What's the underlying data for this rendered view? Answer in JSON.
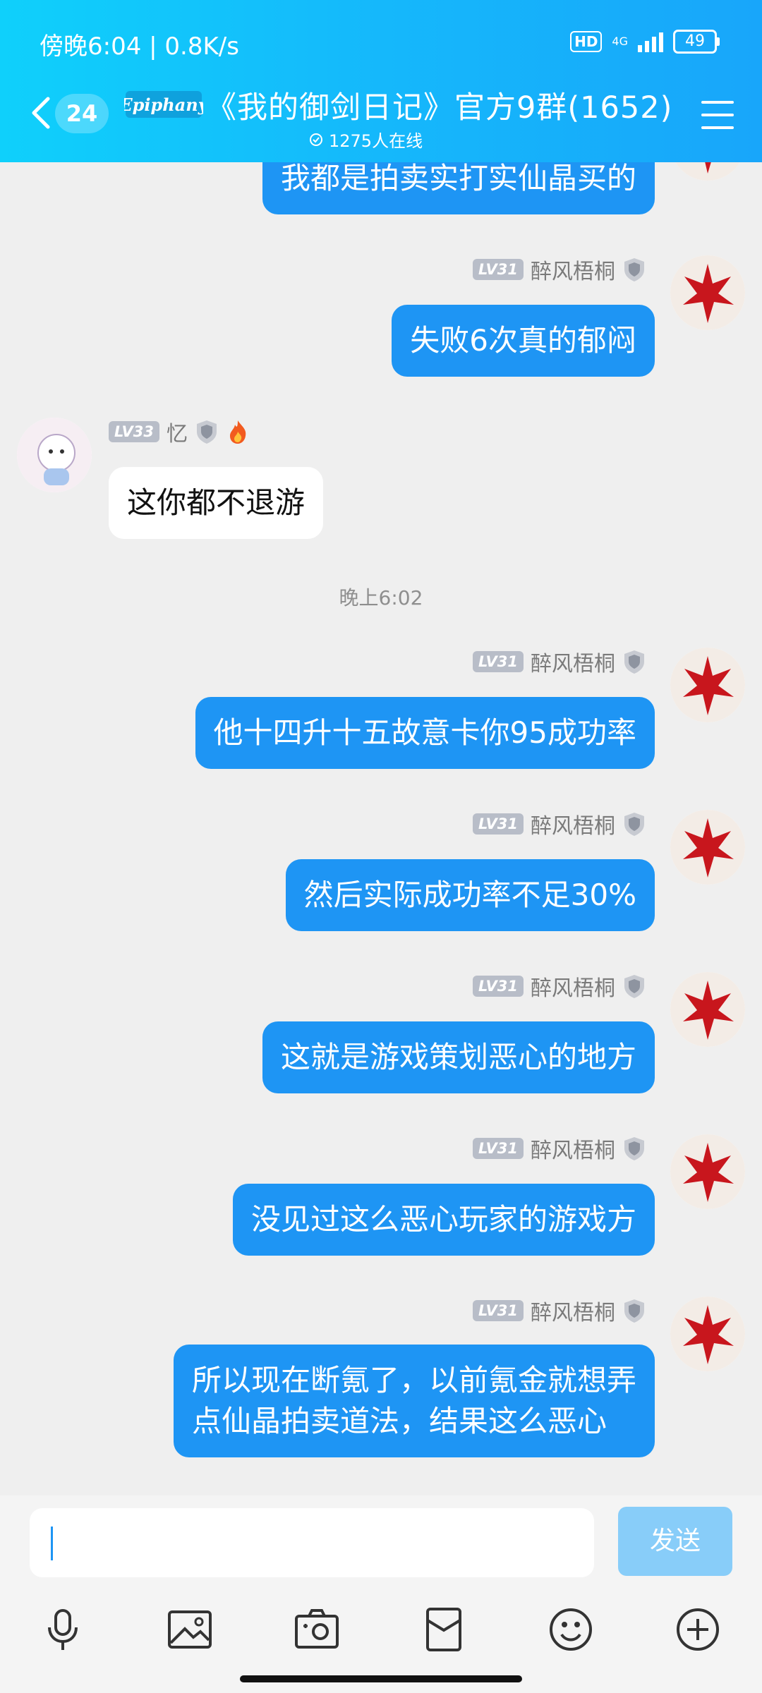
{
  "status_bar": {
    "time_speed": "傍晚6:04 | 0.8K/s",
    "hd": "HD",
    "network": "4G",
    "battery": "49"
  },
  "header": {
    "unread_count": "24",
    "logo_text": "Epiphany",
    "title": "《我的御剑日记》官方9群(1652)",
    "online_count": "1275人在线"
  },
  "messages": [
    {
      "side": "right",
      "text": "我都是拍卖实打实仙晶买的"
    },
    {
      "side": "right",
      "level": "LV31",
      "nick": "醉风梧桐",
      "text": "失败6次真的郁闷"
    },
    {
      "side": "left",
      "level": "LV33",
      "nick": "忆",
      "text": "这你都不退游"
    },
    {
      "type": "time",
      "text": "晚上6:02"
    },
    {
      "side": "right",
      "level": "LV31",
      "nick": "醉风梧桐",
      "text": "他十四升十五故意卡你95成功率"
    },
    {
      "side": "right",
      "level": "LV31",
      "nick": "醉风梧桐",
      "text": "然后实际成功率不足30%"
    },
    {
      "side": "right",
      "level": "LV31",
      "nick": "醉风梧桐",
      "text": "这就是游戏策划恶心的地方"
    },
    {
      "side": "right",
      "level": "LV31",
      "nick": "醉风梧桐",
      "text": "没见过这么恶心玩家的游戏方"
    },
    {
      "side": "right",
      "level": "LV31",
      "nick": "醉风梧桐",
      "text_line1": "所以现在断氪了，以前氪金就想弄",
      "text_line2": "点仙晶拍卖道法，结果这么恶心"
    }
  ],
  "input": {
    "value": "",
    "send_label": "发送"
  },
  "toolbar_icons": [
    "microphone-icon",
    "picture-icon",
    "camera-icon",
    "red-packet-icon",
    "emoji-icon",
    "plus-icon"
  ],
  "colors": {
    "header_gradient_start": "#0fd0fb",
    "header_gradient_end": "#18a6fa",
    "bubble_mine": "#1e95f4",
    "bubble_other": "#ffffff",
    "send_disabled": "#88cdf9"
  }
}
